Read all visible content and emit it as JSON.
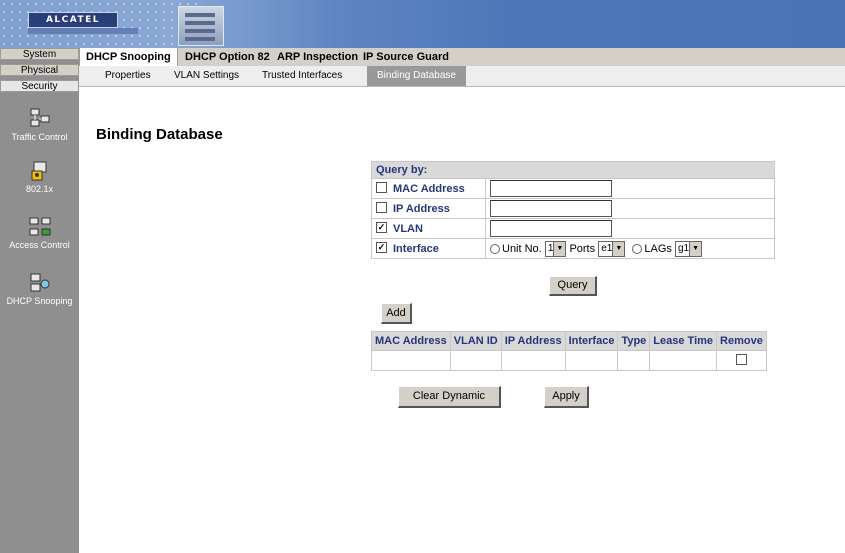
{
  "banner": {
    "brand": "ALCATEL"
  },
  "sidebar": {
    "tabs": [
      "System",
      "Physical",
      "Security"
    ],
    "items": [
      {
        "label": "Traffic Control",
        "icon": "traffic-control-icon"
      },
      {
        "label": "802.1x",
        "icon": "dot1x-icon"
      },
      {
        "label": "Access Control",
        "icon": "access-control-icon"
      },
      {
        "label": "DHCP Snooping",
        "icon": "dhcp-snooping-icon"
      }
    ]
  },
  "tabs": [
    "DHCP Snooping",
    "DHCP Option 82",
    "ARP Inspection",
    "IP Source Guard"
  ],
  "subtabs": [
    "Properties",
    "VLAN Settings",
    "Trusted Interfaces",
    "Binding Database"
  ],
  "page_title": "Binding Database",
  "query": {
    "header": "Query by:",
    "mac_label": "MAC Address",
    "ip_label": "IP Address",
    "vlan_label": "VLAN",
    "interface_label": "Interface",
    "unit_label": "Unit No.",
    "unit_value": "1",
    "ports_label": "Ports",
    "ports_value": "e1",
    "lags_label": "LAGs",
    "lags_value": "g1",
    "query_button": "Query"
  },
  "add_button": "Add",
  "results": {
    "columns": [
      "MAC Address",
      "VLAN ID",
      "IP Address",
      "Interface",
      "Type",
      "Lease Time",
      "Remove"
    ]
  },
  "clear_button": "Clear Dynamic",
  "apply_button": "Apply",
  "colors": {
    "accent": "#26367a",
    "banner": "#4873b6",
    "sidebar": "#8f8f8f"
  }
}
